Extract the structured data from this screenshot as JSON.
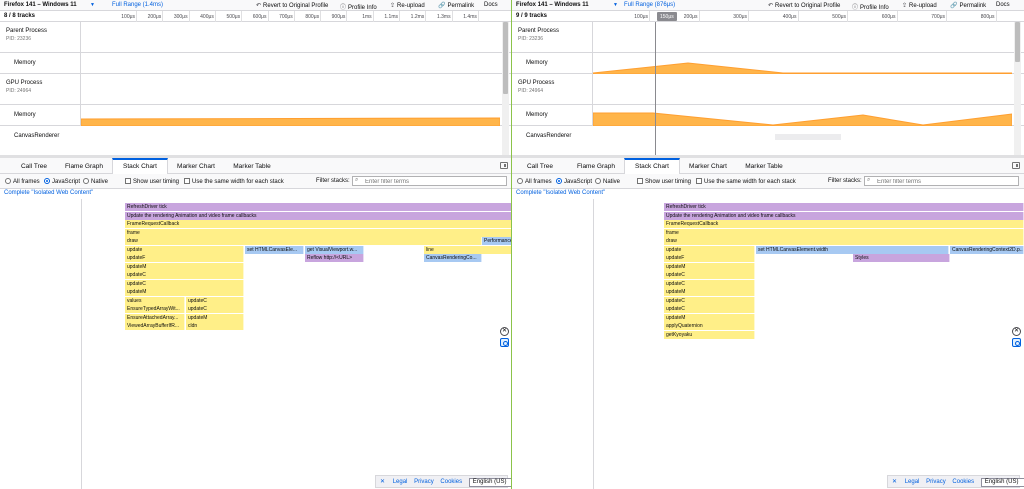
{
  "left": {
    "product": "Firefox 141 – Windows 11",
    "range": "Full Range (1.4ms)",
    "buttons": [
      "Revert to Original Profile",
      "Profile Info",
      "Re-upload",
      "Permalink",
      "Docs"
    ],
    "track_count": "8 / 8 tracks",
    "ticks": [
      "100μs",
      "200μs",
      "300μs",
      "400μs",
      "500μs",
      "600μs",
      "700μs",
      "800μs",
      "900μs",
      "1ms",
      "1.1ms",
      "1.2ms",
      "1.3ms",
      "1.4ms"
    ],
    "tracks": [
      {
        "name": "Parent Process",
        "pid": "PID: 23236"
      },
      {
        "name": "Memory"
      },
      {
        "name": "GPU Process",
        "pid": "PID: 24964"
      },
      {
        "name": "Memory"
      },
      {
        "name": "CanvasRenderer"
      }
    ],
    "tabs": [
      "Call Tree",
      "Flame Graph",
      "Stack Chart",
      "Marker Chart",
      "Marker Table"
    ],
    "options": {
      "all_frames": "All frames",
      "javascript": "JavaScript",
      "native": "Native",
      "user_timing": "Show user timing",
      "same_width": "Use the same width for each stack"
    },
    "filter_label": "Filter stacks:",
    "filter_placeholder": "Enter filter terms",
    "breadcrumb": "Complete \"Isolated Web Content\"",
    "rows": [
      [
        "RefreshDriver tick"
      ],
      [
        "Update the rendering Animation and video frame callbacks"
      ],
      [
        "FrameRequestCallback"
      ],
      [
        "frame"
      ],
      [
        "draw",
        "Performance..."
      ],
      [
        "update",
        "set HTMLCanvasEle...",
        "get VisualViewport.w...",
        "line"
      ],
      [
        "updateF",
        "Reflow http://<URL>",
        "CanvasRenderingCo..."
      ],
      [
        "updateM"
      ],
      [
        "updateC"
      ],
      [
        "updateC"
      ],
      [
        "updateM"
      ],
      [
        "values",
        "updateC"
      ],
      [
        "EnsureTypedArrayWit...",
        "updateC"
      ],
      [
        "EnsureAttachedArray...",
        "updateM"
      ],
      [
        "ViewedArrayBufferIfR...",
        "cldn"
      ]
    ]
  },
  "right": {
    "product": "Firefox 141 – Windows 11",
    "range": "Full Range (876μs)",
    "buttons": [
      "Revert to Original Profile",
      "Profile Info",
      "Re-upload",
      "Permalink",
      "Docs"
    ],
    "track_count": "9 / 9 tracks",
    "selection_label": "150μs",
    "ticks": [
      "100μs",
      "200μs",
      "300μs",
      "400μs",
      "500μs",
      "600μs",
      "700μs",
      "800μs"
    ],
    "tracks": [
      {
        "name": "Parent Process",
        "pid": "PID: 23236"
      },
      {
        "name": "Memory"
      },
      {
        "name": "GPU Process",
        "pid": "PID: 24964"
      },
      {
        "name": "Memory"
      },
      {
        "name": "CanvasRenderer"
      }
    ],
    "tabs": [
      "Call Tree",
      "Flame Graph",
      "Stack Chart",
      "Marker Chart",
      "Marker Table"
    ],
    "options": {
      "all_frames": "All frames",
      "javascript": "JavaScript",
      "native": "Native",
      "user_timing": "Show user timing",
      "same_width": "Use the same width for each stack"
    },
    "filter_label": "Filter stacks:",
    "filter_placeholder": "Enter filter terms",
    "breadcrumb": "Complete \"Isolated Web Content\"",
    "rows": [
      [
        "RefreshDriver tick"
      ],
      [
        "Update the rendering Animation and video frame callbacks"
      ],
      [
        "FrameRequestCallback"
      ],
      [
        "frame"
      ],
      [
        "draw"
      ],
      [
        "update",
        "set HTMLCanvasElement.width",
        "CanvasRenderingContext2D.p..."
      ],
      [
        "updateF",
        "Styles"
      ],
      [
        "updateM"
      ],
      [
        "updateC"
      ],
      [
        "updateC"
      ],
      [
        "updateM"
      ],
      [
        "updateC"
      ],
      [
        "updateC"
      ],
      [
        "updateM"
      ],
      [
        "applyQuaternion"
      ],
      [
        "getKyoyaku"
      ]
    ]
  },
  "footer": {
    "close": "✕",
    "legal": "Legal",
    "privacy": "Privacy",
    "cookies": "Cookies",
    "language": "English (US)"
  },
  "colors": {
    "accent": "#0060df",
    "js": "#ffef88",
    "layout": "#c8a5de",
    "dom": "#a7c9f2",
    "memory": "#ff9f30"
  }
}
